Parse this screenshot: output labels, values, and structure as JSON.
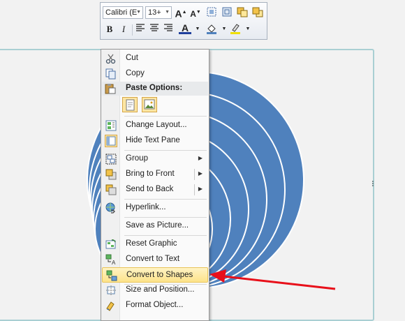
{
  "toolbar": {
    "font_name": "Calibri (E",
    "font_size": "13+",
    "icons": [
      "grow-font-icon",
      "shrink-font-icon",
      "bring-forward-icon",
      "send-backward-icon",
      "shape-fill-icon",
      "shape-outline-icon",
      "bold-icon",
      "italic-icon",
      "align-left-icon",
      "center-icon",
      "align-right-icon",
      "font-color-icon",
      "fill-color-icon",
      "highlight-icon"
    ]
  },
  "menu": {
    "items": [
      {
        "label": "Cut",
        "icon": "cut-icon"
      },
      {
        "label": "Copy",
        "icon": "copy-icon"
      },
      {
        "label": "Paste Options:",
        "icon": "paste-icon"
      },
      {
        "label": "Change Layout...",
        "icon": "change-layout-icon"
      },
      {
        "label": "Hide Text Pane",
        "icon": "text-pane-icon"
      },
      {
        "label": "Group",
        "icon": "group-icon",
        "submenu": true
      },
      {
        "label": "Bring to Front",
        "icon": "bring-front-icon",
        "submenu": true
      },
      {
        "label": "Send to Back",
        "icon": "send-back-icon",
        "submenu": true
      },
      {
        "label": "Hyperlink...",
        "icon": "hyperlink-icon"
      },
      {
        "label": "Save as Picture...",
        "icon": ""
      },
      {
        "label": "Reset Graphic",
        "icon": "reset-graphic-icon"
      },
      {
        "label": "Convert to Text",
        "icon": "convert-text-icon"
      },
      {
        "label": "Convert to Shapes",
        "icon": "convert-shapes-icon",
        "highlighted": true
      },
      {
        "label": "Size and Position...",
        "icon": "size-position-icon"
      },
      {
        "label": "Format Object...",
        "icon": "format-object-icon"
      }
    ]
  },
  "colors": {
    "circle_fill": "#4f81bd",
    "circle_stroke": "#ffffff",
    "highlight": "#fde38a",
    "arrow": "#e8101a"
  }
}
